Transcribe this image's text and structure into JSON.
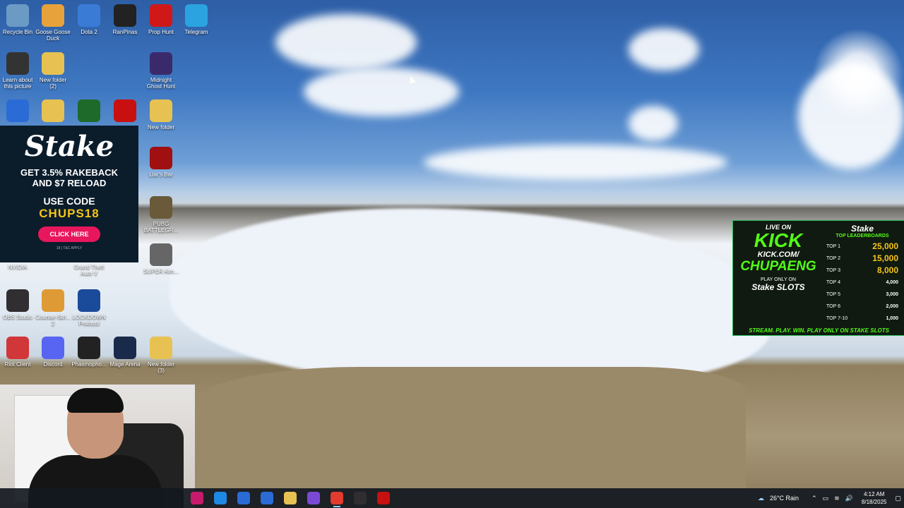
{
  "desktop": {
    "icons": [
      {
        "label": "Recycle Bin",
        "icon": "recycle-bin-icon",
        "color": "#6b9ac4"
      },
      {
        "label": "Goose Goose Duck",
        "icon": "goose-icon",
        "color": "#e8a23c"
      },
      {
        "label": "Dota 2",
        "icon": "dota-icon",
        "color": "#3a7bd5"
      },
      {
        "label": "RanPinas",
        "icon": "ranpinas-icon",
        "color": "#222222"
      },
      {
        "label": "Prop Hunt",
        "icon": "prop-hunt-icon",
        "color": "#d01818"
      },
      {
        "label": "Telegram",
        "icon": "telegram-icon",
        "color": "#2aa3e0"
      },
      {
        "label": "Learn about this picture",
        "icon": "camera-icon",
        "color": "#333333"
      },
      {
        "label": "New folder (2)",
        "icon": "folder-icon",
        "color": "#e7c253"
      },
      {
        "label": "Midnight Ghost Hunt",
        "icon": "ghost-hunt-icon",
        "color": "#3b2a6b"
      },
      {
        "label": "",
        "icon": "app-icon",
        "color": "#2a6bd5"
      },
      {
        "label": "",
        "icon": "file-icon",
        "color": "#e7c253"
      },
      {
        "label": "",
        "icon": "app-icon",
        "color": "#1e6a2a"
      },
      {
        "label": "",
        "icon": "among-us-icon",
        "color": "#c81010"
      },
      {
        "label": "New folder",
        "icon": "folder-icon",
        "color": "#e7c253"
      },
      {
        "label": "Liar's Bar",
        "icon": "liars-bar-icon",
        "color": "#a01010"
      },
      {
        "label": "PUBG BATTLEGR...",
        "icon": "pubg-icon",
        "color": "#6a5a3a"
      },
      {
        "label": "SUPER Aim...",
        "icon": "super-icon",
        "color": "#666666"
      },
      {
        "label": "NVIDIA",
        "icon": "nvidia-icon",
        "color": "#76b900"
      },
      {
        "label": "Grand Theft Auto V",
        "icon": "gta-icon",
        "color": "#333333"
      },
      {
        "label": "OBS Studio",
        "icon": "obs-icon",
        "color": "#302e31"
      },
      {
        "label": "Counter-Stri... 2",
        "icon": "cs2-icon",
        "color": "#de9b35"
      },
      {
        "label": "LOCKDOWN Protocol",
        "icon": "lockdown-icon",
        "color": "#1a4a9a"
      },
      {
        "label": "Riot Client",
        "icon": "riot-icon",
        "color": "#d13639"
      },
      {
        "label": "Discord",
        "icon": "discord-icon",
        "color": "#5865f2"
      },
      {
        "label": "Phasmopho...",
        "icon": "phasmophobia-icon",
        "color": "#222222"
      },
      {
        "label": "Mage Arena",
        "icon": "mage-arena-icon",
        "color": "#1a2a4a"
      },
      {
        "label": "New folder (3)",
        "icon": "folder-icon",
        "color": "#e7c253"
      }
    ]
  },
  "ad_stake": {
    "logo": "Stake",
    "line1": "GET 3.5% RAKEBACK",
    "line2": "AND $7 RELOAD",
    "use_code": "USE CODE",
    "code": "CHUPS18",
    "button": "CLICK HERE",
    "fine": "18 | T&C APPLY"
  },
  "ad_kick": {
    "live": "LIVE ON",
    "kick": "KICK",
    "url": "KICK.COM/",
    "channel": "CHUPAENG",
    "play_only": "PLAY ONLY ON",
    "slots": "Stake SLOTS",
    "stream": "STREAM. PLAY. WIN. PLAY ONLY ON STAKE SLOTS",
    "brand": "Stake",
    "leaderboard_title": "TOP LEADERBOARDS",
    "leaderboard": [
      {
        "rank": "TOP 1",
        "amount": "25,000"
      },
      {
        "rank": "TOP 2",
        "amount": "15,000"
      },
      {
        "rank": "TOP 3",
        "amount": "8,000"
      },
      {
        "rank": "TOP 4",
        "amount": "4,000"
      },
      {
        "rank": "TOP 5",
        "amount": "3,000"
      },
      {
        "rank": "TOP 6",
        "amount": "2,000"
      },
      {
        "rank": "TOP 7-10",
        "amount": "1,000"
      }
    ]
  },
  "taskbar": {
    "apps": [
      {
        "name": "stream-deck-icon",
        "color": "#c81a6a"
      },
      {
        "name": "edge-icon",
        "color": "#1e88e5"
      },
      {
        "name": "store-icon",
        "color": "#2a6bd5"
      },
      {
        "name": "app-icon",
        "color": "#2a6bd5"
      },
      {
        "name": "file-explorer-icon",
        "color": "#e7c253"
      },
      {
        "name": "obs-icon",
        "color": "#7a4ad5"
      },
      {
        "name": "chrome-icon",
        "color": "#e33b2e"
      },
      {
        "name": "obs-icon",
        "color": "#302e31"
      },
      {
        "name": "kick-app-icon",
        "color": "#c81010"
      }
    ],
    "weather": "26°C Rain",
    "time": "4:12 AM",
    "date": "8/18/2025"
  }
}
